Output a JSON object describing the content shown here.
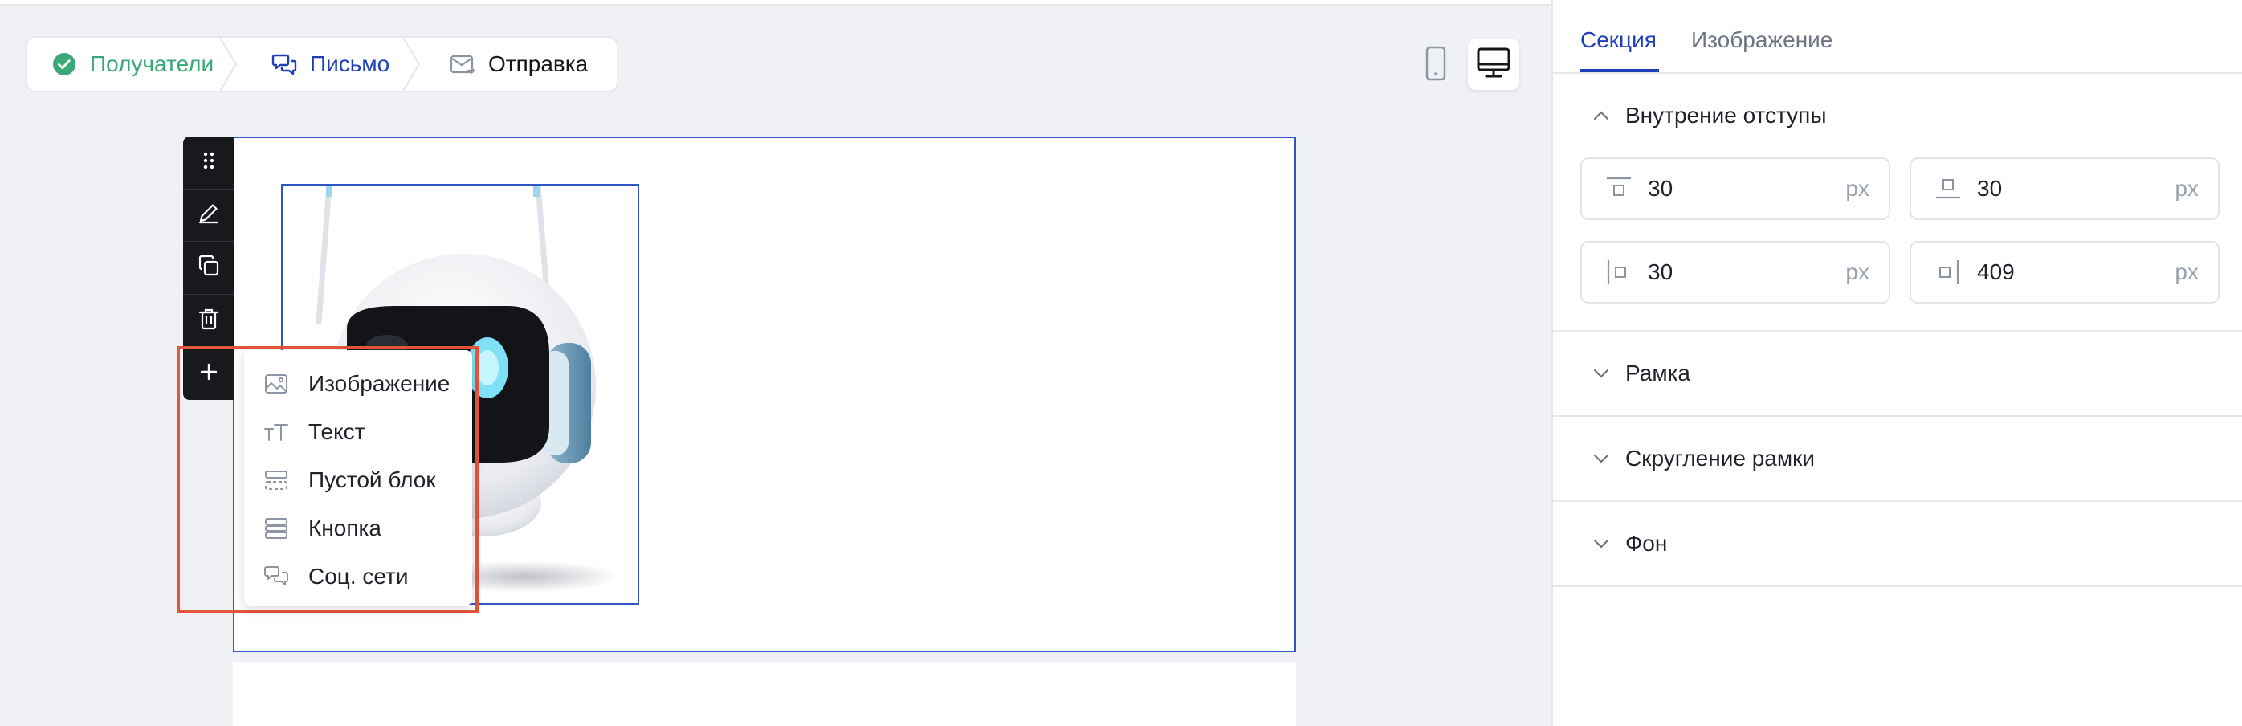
{
  "steps": [
    {
      "label": "Получатели",
      "state": "done",
      "icon": "check-circle-icon"
    },
    {
      "label": "Письмо",
      "state": "active",
      "icon": "chat-bubbles-icon"
    },
    {
      "label": "Отправка",
      "state": "pending",
      "icon": "mail-send-icon"
    }
  ],
  "device": {
    "mobile_icon": "mobile-icon",
    "desktop_icon": "desktop-icon",
    "selected": "desktop"
  },
  "toolbar": {
    "icons": [
      "drag-handle-icon",
      "edit-icon",
      "duplicate-icon",
      "delete-icon",
      "plus-icon"
    ]
  },
  "add_menu": {
    "items": [
      {
        "label": "Изображение",
        "icon": "image-icon"
      },
      {
        "label": "Текст",
        "icon": "text-icon"
      },
      {
        "label": "Пустой блок",
        "icon": "empty-block-icon"
      },
      {
        "label": "Кнопка",
        "icon": "button-block-icon"
      },
      {
        "label": "Соц. сети",
        "icon": "social-icon"
      }
    ]
  },
  "panel": {
    "tabs": [
      {
        "label": "Секция",
        "active": true
      },
      {
        "label": "Изображение",
        "active": false
      }
    ],
    "padding": {
      "title": "Внутрение отступы",
      "top": {
        "value": "30",
        "unit": "px"
      },
      "bottom": {
        "value": "30",
        "unit": "px"
      },
      "left": {
        "value": "30",
        "unit": "px"
      },
      "right": {
        "value": "409",
        "unit": "px"
      }
    },
    "sections": [
      {
        "label": "Рамка"
      },
      {
        "label": "Скругление рамки"
      },
      {
        "label": "Фон"
      }
    ]
  },
  "colors": {
    "accent": "#1f3fb8",
    "success": "#3aa877",
    "highlight": "#e5553b",
    "selection": "#2f55c6"
  }
}
